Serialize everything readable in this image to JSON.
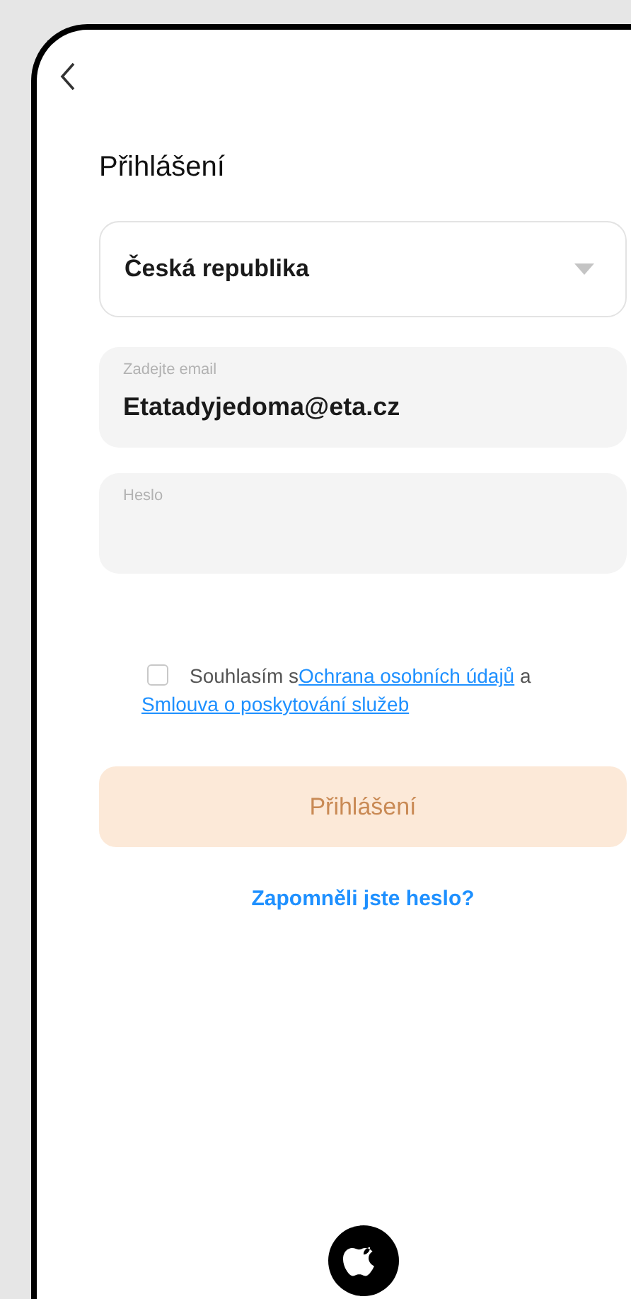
{
  "header": {
    "title": "Přihlášení"
  },
  "country_select": {
    "value": "Česká republika"
  },
  "email_field": {
    "label": "Zadejte email",
    "value": "Etatadyjedoma@eta.cz"
  },
  "password_field": {
    "label": "Heslo"
  },
  "consent": {
    "checked": false,
    "text": "Souhlasím s",
    "link_1": "Ochrana osobních údajů",
    "joiner": "a",
    "link_2": "Smlouva o poskytování služeb"
  },
  "login_button": {
    "label": "Přihlášení",
    "disabled": true
  },
  "forgot_link": "Zapomněli jste heslo?"
}
